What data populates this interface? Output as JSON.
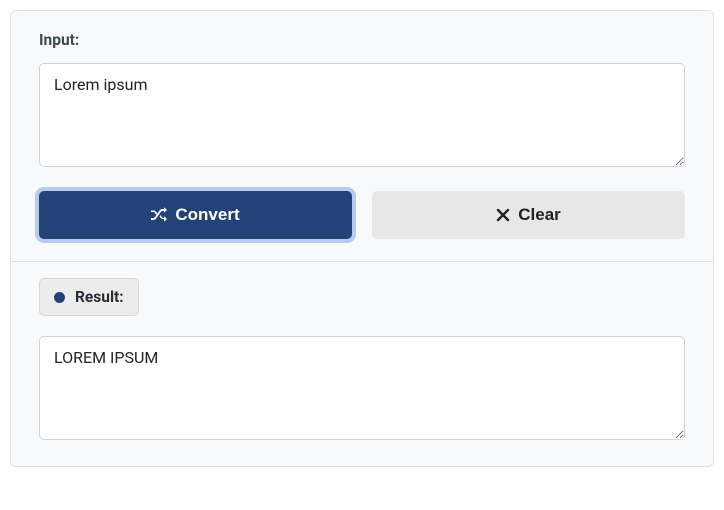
{
  "input": {
    "label": "Input:",
    "value": "Lorem ipsum"
  },
  "buttons": {
    "convert": "Convert",
    "clear": "Clear"
  },
  "result": {
    "label": "Result:",
    "value": "LOREM IPSUM"
  }
}
